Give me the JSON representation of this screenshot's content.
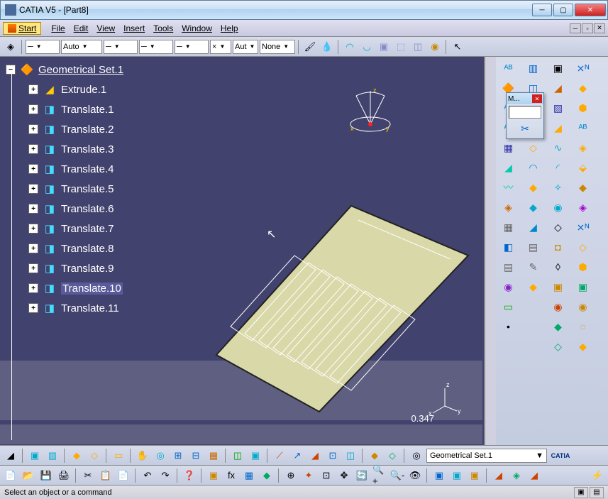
{
  "window": {
    "title": "CATIA V5 - [Part8]"
  },
  "menubar": {
    "start": "Start",
    "items": [
      "File",
      "Edit",
      "View",
      "Insert",
      "Tools",
      "Window",
      "Help"
    ]
  },
  "top_toolbar": {
    "auto": "Auto",
    "aut": "Aut",
    "none": "None"
  },
  "tree": {
    "root": "Geometrical Set.1",
    "items": [
      "Extrude.1",
      "Translate.1",
      "Translate.2",
      "Translate.3",
      "Translate.4",
      "Translate.5",
      "Translate.6",
      "Translate.7",
      "Translate.8",
      "Translate.9",
      "Translate.10",
      "Translate.11"
    ]
  },
  "viewport": {
    "scale": "0.347",
    "axes": {
      "x": "x",
      "y": "y",
      "z": "z"
    }
  },
  "float_toolbar": {
    "title": "M..."
  },
  "bottom": {
    "dropdown": "Geometrical Set.1",
    "logo": "CATIA"
  },
  "status": {
    "text": "Select an object or a command"
  }
}
